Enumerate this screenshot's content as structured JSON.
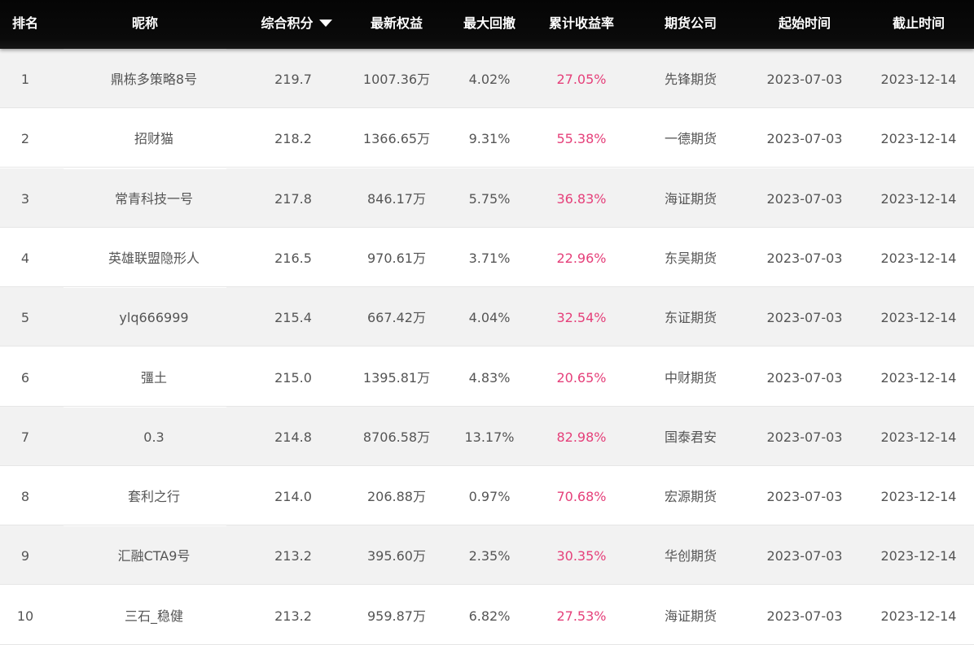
{
  "columns": {
    "rank": "排名",
    "nickname": "昵称",
    "score": "综合积分",
    "equity": "最新权益",
    "drawdown": "最大回撤",
    "return": "累计收益率",
    "company": "期货公司",
    "start": "起始时间",
    "end": "截止时间"
  },
  "sort": {
    "column": "score",
    "direction": "desc",
    "icon": "sort-desc-triangle-icon"
  },
  "colors": {
    "header_bg": "#0a0a0a",
    "return_text": "#e5407a",
    "odd_row": "#f2f2f2"
  },
  "rows": [
    {
      "rank": "1",
      "nickname": "鼎栋多策略8号",
      "score": "219.7",
      "equity": "1007.36万",
      "drawdown": "4.02%",
      "return": "27.05%",
      "company": "先锋期货",
      "start": "2023-07-03",
      "end": "2023-12-14"
    },
    {
      "rank": "2",
      "nickname": "招财猫",
      "score": "218.2",
      "equity": "1366.65万",
      "drawdown": "9.31%",
      "return": "55.38%",
      "company": "一德期货",
      "start": "2023-07-03",
      "end": "2023-12-14"
    },
    {
      "rank": "3",
      "nickname": "常青科技一号",
      "score": "217.8",
      "equity": "846.17万",
      "drawdown": "5.75%",
      "return": "36.83%",
      "company": "海证期货",
      "start": "2023-07-03",
      "end": "2023-12-14"
    },
    {
      "rank": "4",
      "nickname": "英雄联盟隐形人",
      "score": "216.5",
      "equity": "970.61万",
      "drawdown": "3.71%",
      "return": "22.96%",
      "company": "东吴期货",
      "start": "2023-07-03",
      "end": "2023-12-14"
    },
    {
      "rank": "5",
      "nickname": "ylq666999",
      "score": "215.4",
      "equity": "667.42万",
      "drawdown": "4.04%",
      "return": "32.54%",
      "company": "东证期货",
      "start": "2023-07-03",
      "end": "2023-12-14"
    },
    {
      "rank": "6",
      "nickname": "彊土",
      "score": "215.0",
      "equity": "1395.81万",
      "drawdown": "4.83%",
      "return": "20.65%",
      "company": "中财期货",
      "start": "2023-07-03",
      "end": "2023-12-14"
    },
    {
      "rank": "7",
      "nickname": "0.3",
      "score": "214.8",
      "equity": "8706.58万",
      "drawdown": "13.17%",
      "return": "82.98%",
      "company": "国泰君安",
      "start": "2023-07-03",
      "end": "2023-12-14"
    },
    {
      "rank": "8",
      "nickname": "套利之行",
      "score": "214.0",
      "equity": "206.88万",
      "drawdown": "0.97%",
      "return": "70.68%",
      "company": "宏源期货",
      "start": "2023-07-03",
      "end": "2023-12-14"
    },
    {
      "rank": "9",
      "nickname": "汇融CTA9号",
      "score": "213.2",
      "equity": "395.60万",
      "drawdown": "2.35%",
      "return": "30.35%",
      "company": "华创期货",
      "start": "2023-07-03",
      "end": "2023-12-14"
    },
    {
      "rank": "10",
      "nickname": "三石_稳健",
      "score": "213.2",
      "equity": "959.87万",
      "drawdown": "6.82%",
      "return": "27.53%",
      "company": "海证期货",
      "start": "2023-07-03",
      "end": "2023-12-14"
    }
  ]
}
